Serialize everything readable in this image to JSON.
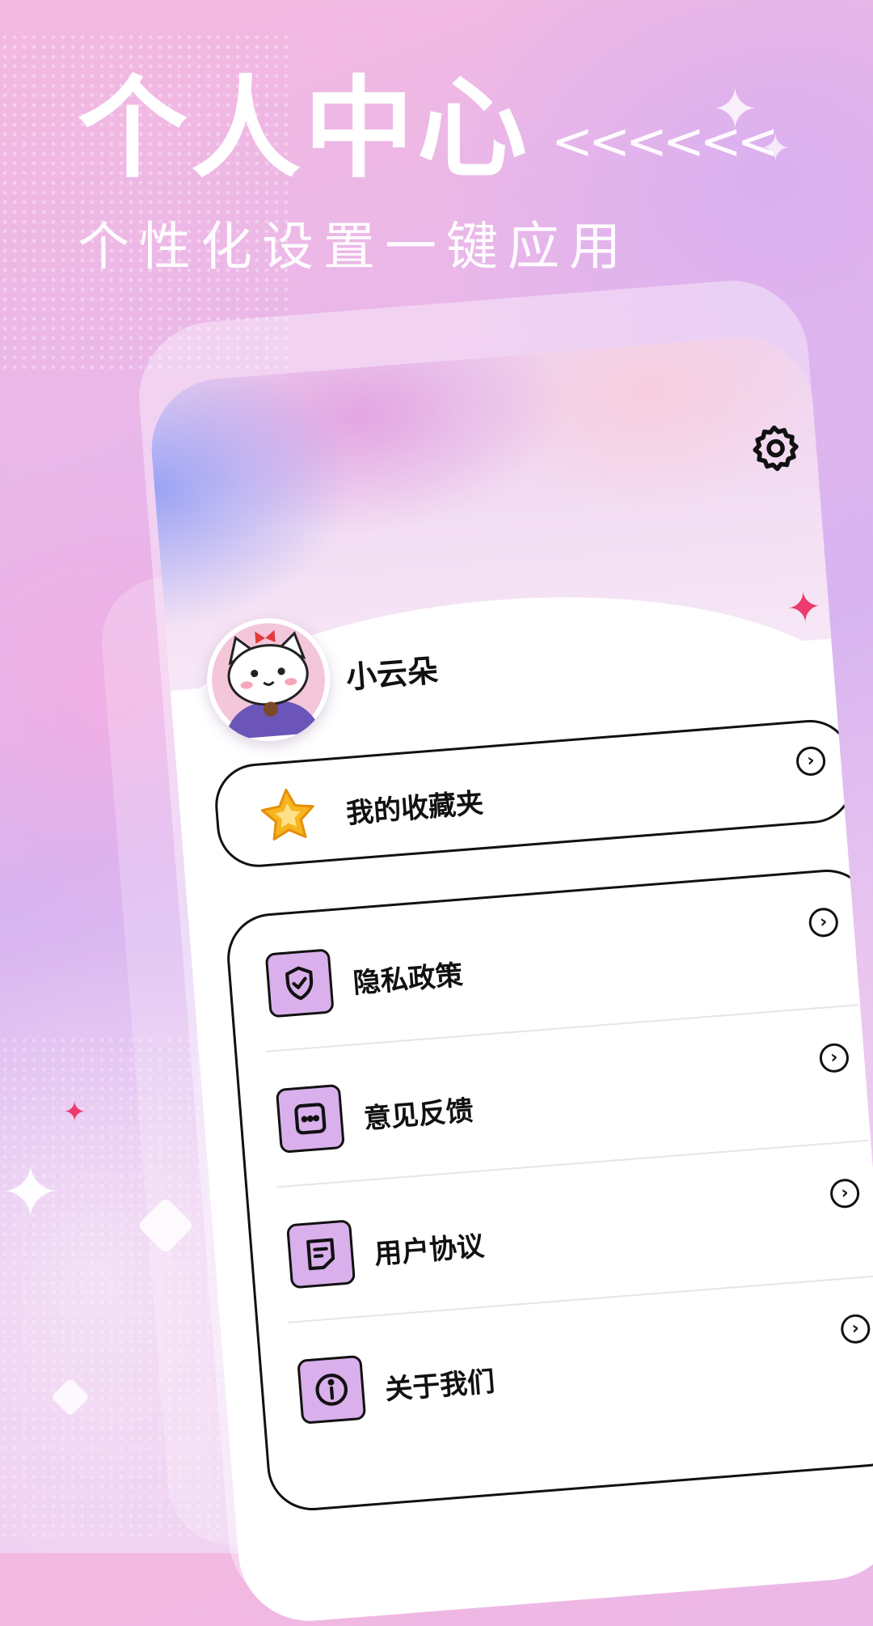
{
  "hero": {
    "title": "个人中心",
    "chevrons": "<<<<<<",
    "subtitle": "个性化设置一键应用"
  },
  "profile": {
    "username": "小云朵",
    "avatar_icon": "cat-avatar-icon",
    "settings_icon": "gear-icon"
  },
  "favorites": {
    "label": "我的收藏夹",
    "icon": "star-icon",
    "chevron": "›"
  },
  "menu": {
    "items": [
      {
        "label": "隐私政策",
        "icon": "shield-check-icon",
        "chevron": "›"
      },
      {
        "label": "意见反馈",
        "icon": "message-dots-icon",
        "chevron": "›"
      },
      {
        "label": "用户协议",
        "icon": "document-icon",
        "chevron": "›"
      },
      {
        "label": "关于我们",
        "icon": "info-icon",
        "chevron": "›"
      }
    ]
  },
  "colors": {
    "accent_purple": "#d9b0ec",
    "star_gold": "#f6b51e",
    "sparkle_pink": "#ec3b6e",
    "text_dark": "#111111"
  }
}
